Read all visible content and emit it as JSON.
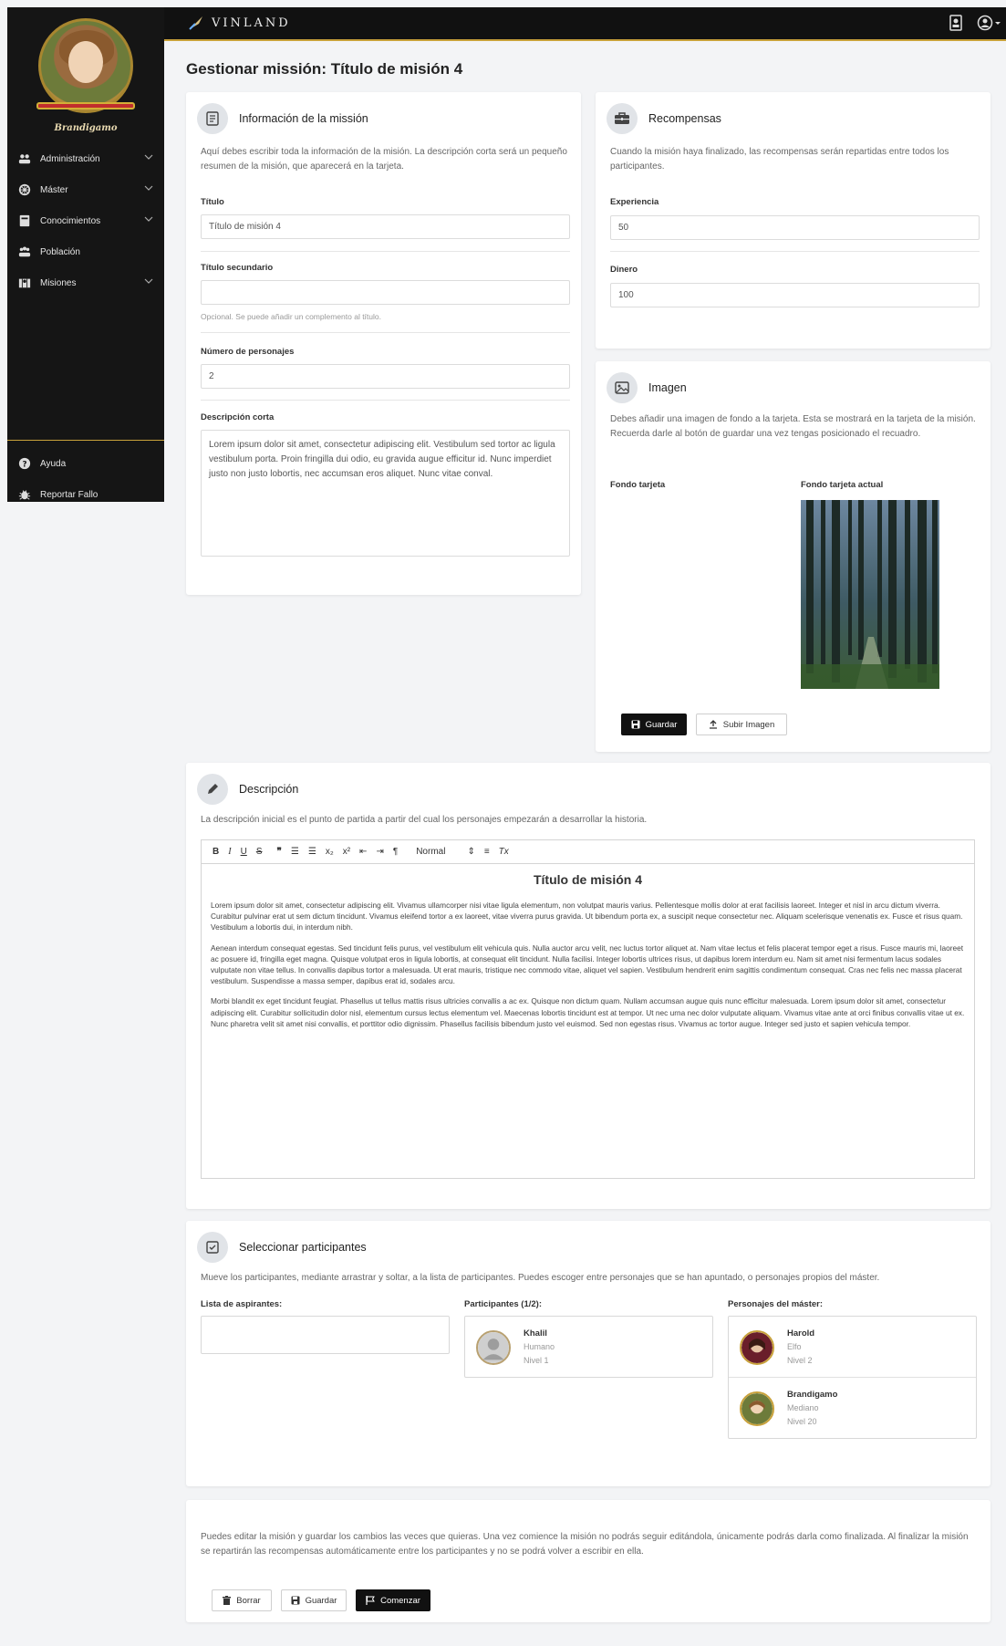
{
  "app": {
    "brand": "VINLAND"
  },
  "user": {
    "name": "Brandigamo"
  },
  "sidebar": {
    "items": [
      {
        "label": "Administración",
        "icon": "users-cog-icon"
      },
      {
        "label": "Máster",
        "icon": "dharma-wheel-icon"
      },
      {
        "label": "Conocimientos",
        "icon": "book-icon"
      },
      {
        "label": "Población",
        "icon": "people-icon"
      },
      {
        "label": "Misiones",
        "icon": "map-marked-icon"
      }
    ],
    "bottom": [
      {
        "label": "Ayuda",
        "icon": "question-circle-icon"
      },
      {
        "label": "Reportar Fallo",
        "icon": "bug-icon"
      }
    ]
  },
  "page": {
    "title": "Gestionar missión: Título de misión 4"
  },
  "info": {
    "title": "Información de la missión",
    "desc": "Aquí debes escribir toda la información de la misión. La descripción corta será un pequeño resumen de la misión, que aparecerá en la tarjeta.",
    "titulo_label": "Título",
    "titulo_value": "Título de misión 4",
    "subtitulo_label": "Título secundario",
    "subtitulo_value": "",
    "subtitulo_hint": "Opcional. Se puede añadir un complemento al título.",
    "personajes_label": "Número de personajes",
    "personajes_value": "2",
    "desc_corta_label": "Descripción corta",
    "desc_corta_value": "Lorem ipsum dolor sit amet, consectetur adipiscing elit. Vestibulum sed tortor ac ligula vestibulum porta. Proin fringilla dui odio, eu gravida augue efficitur id. Nunc imperdiet justo non justo lobortis, nec accumsan eros aliquet. Nunc vitae conval."
  },
  "rewards": {
    "title": "Recompensas",
    "desc": "Cuando la misión haya finalizado, las recompensas serán repartidas entre todos los participantes.",
    "exp_label": "Experiencia",
    "exp_value": "50",
    "money_label": "Dinero",
    "money_value": "100"
  },
  "image": {
    "title": "Imagen",
    "desc": "Debes añadir una imagen de fondo a la tarjeta. Esta se mostrará en la tarjeta de la misión. Recuerda darle al botón de guardar una vez tengas posicionado el recuadro.",
    "bg_label": "Fondo tarjeta",
    "current_label": "Fondo tarjeta actual",
    "save_btn": "Guardar",
    "upload_btn": "Subir Imagen"
  },
  "description": {
    "title": "Descripción",
    "desc": "La descripción inicial es el punto de partida a partir del cual los personajes empezarán a desarrollar la historia.",
    "toolbar_format": "Normal",
    "editor_heading": "Título de misión 4",
    "paragraphs": [
      "Lorem ipsum dolor sit amet, consectetur adipiscing elit. Vivamus ullamcorper nisi vitae ligula elementum, non volutpat mauris varius. Pellentesque mollis dolor at erat facilisis laoreet. Integer et nisl in arcu dictum viverra. Curabitur pulvinar erat ut sem dictum tincidunt. Vivamus eleifend tortor a ex laoreet, vitae viverra purus gravida. Ut bibendum porta ex, a suscipit neque consectetur nec. Aliquam scelerisque venenatis ex. Fusce et risus quam. Vestibulum a lobortis dui, in interdum nibh.",
      "Aenean interdum consequat egestas. Sed tincidunt felis purus, vel vestibulum elit vehicula quis. Nulla auctor arcu velit, nec luctus tortor aliquet at. Nam vitae lectus et felis placerat tempor eget a risus. Fusce mauris mi, laoreet ac posuere id, fringilla eget magna. Quisque volutpat eros in ligula lobortis, at consequat elit tincidunt. Nulla facilisi. Integer lobortis ultrices risus, ut dapibus lorem interdum eu. Nam sit amet nisi fermentum lacus sodales vulputate non vitae tellus. In convallis dapibus tortor a malesuada. Ut erat mauris, tristique nec commodo vitae, aliquet vel sapien. Vestibulum hendrerit enim sagittis condimentum consequat. Cras nec felis nec massa placerat vestibulum. Suspendisse a massa semper, dapibus erat id, sodales arcu.",
      "Morbi blandit ex eget tincidunt feugiat. Phasellus ut tellus mattis risus ultricies convallis a ac ex. Quisque non dictum quam. Nullam accumsan augue quis nunc efficitur malesuada. Lorem ipsum dolor sit amet, consectetur adipiscing elit. Curabitur sollicitudin dolor nisl, elementum cursus lectus elementum vel. Maecenas lobortis tincidunt est at tempor. Ut nec urna nec dolor vulputate aliquam. Vivamus vitae ante at orci finibus convallis vitae ut ex. Nunc pharetra velit sit amet nisi convallis, et porttitor odio dignissim. Phasellus facilisis bibendum justo vel euismod. Sed non egestas risus. Vivamus ac tortor augue. Integer sed justo et sapien vehicula tempor."
    ]
  },
  "participants": {
    "title": "Seleccionar participantes",
    "desc": "Mueve los participantes, mediante arrastrar y soltar, a la lista de participantes. Puedes escoger entre personajes que se han apuntado, o personajes propios del máster.",
    "col1": "Lista de aspirantes:",
    "col2": "Participantes (1/2):",
    "col3": "Personajes del máster:",
    "list2": [
      {
        "name": "Khalil",
        "race": "Humano",
        "level": "Nivel 1"
      }
    ],
    "list3": [
      {
        "name": "Harold",
        "race": "Elfo",
        "level": "Nivel 2"
      },
      {
        "name": "Brandigamo",
        "race": "Mediano",
        "level": "Nivel 20"
      }
    ]
  },
  "footer": {
    "desc": "Puedes editar la misión y guardar los cambios las veces que quieras. Una vez comience la misión no podrás seguir editándola, únicamente podrás darla como finalizada. Al finalizar la misión se repartirán las recompensas automáticamente entre los participantes y no se podrá volver a escribir en ella.",
    "delete_btn": "Borrar",
    "save_btn": "Guardar",
    "start_btn": "Comenzar"
  }
}
